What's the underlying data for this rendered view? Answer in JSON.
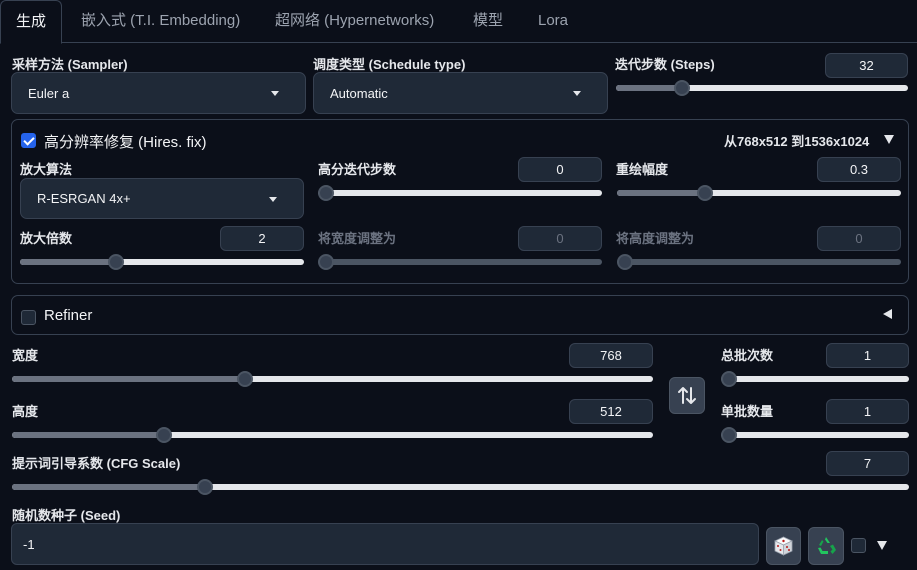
{
  "tabs": [
    {
      "label": "生成",
      "active": true
    },
    {
      "label": "嵌入式 (T.I. Embedding)",
      "active": false
    },
    {
      "label": "超网络 (Hypernetworks)",
      "active": false
    },
    {
      "label": "模型",
      "active": false
    },
    {
      "label": "Lora",
      "active": false
    }
  ],
  "sampler": {
    "label": "采样方法 (Sampler)",
    "value": "Euler a"
  },
  "schedule": {
    "label": "调度类型 (Schedule type)",
    "value": "Automatic"
  },
  "steps": {
    "label": "迭代步数 (Steps)",
    "value": "32",
    "min": 1,
    "max": 150,
    "level": 0.21
  },
  "hires": {
    "label": "高分辨率修复 (Hires. fix)",
    "checked": true,
    "info": "从768x512 到1536x1024",
    "upscaler": {
      "label": "放大算法",
      "value": "R-ESRGAN 4x+"
    },
    "hires_steps": {
      "label": "高分迭代步数",
      "value": "0",
      "level": 0.0
    },
    "denoise": {
      "label": "重绘幅度",
      "value": "0.3",
      "level": 0.3
    },
    "upscale_by": {
      "label": "放大倍数",
      "value": "2",
      "level": 0.33
    },
    "resize_w": {
      "label": "将宽度调整为",
      "value": "0",
      "level": 0.0
    },
    "resize_h": {
      "label": "将高度调整为",
      "value": "0",
      "level": 0.0
    }
  },
  "refiner": {
    "label": "Refiner",
    "checked": false
  },
  "width": {
    "label": "宽度",
    "value": "768",
    "level": 0.36
  },
  "height": {
    "label": "高度",
    "value": "512",
    "level": 0.23
  },
  "batch_count": {
    "label": "总批次数",
    "value": "1",
    "level": 0.0
  },
  "batch_size": {
    "label": "单批数量",
    "value": "1",
    "level": 0.0
  },
  "cfg": {
    "label": "提示词引导系数 (CFG Scale)",
    "value": "7",
    "level": 0.21
  },
  "seed": {
    "label": "随机数种子 (Seed)",
    "value": "-1"
  },
  "colors": {
    "accent": "#2563eb",
    "background": "#0b0f19",
    "panel": "#1f2937",
    "border": "#374151"
  }
}
